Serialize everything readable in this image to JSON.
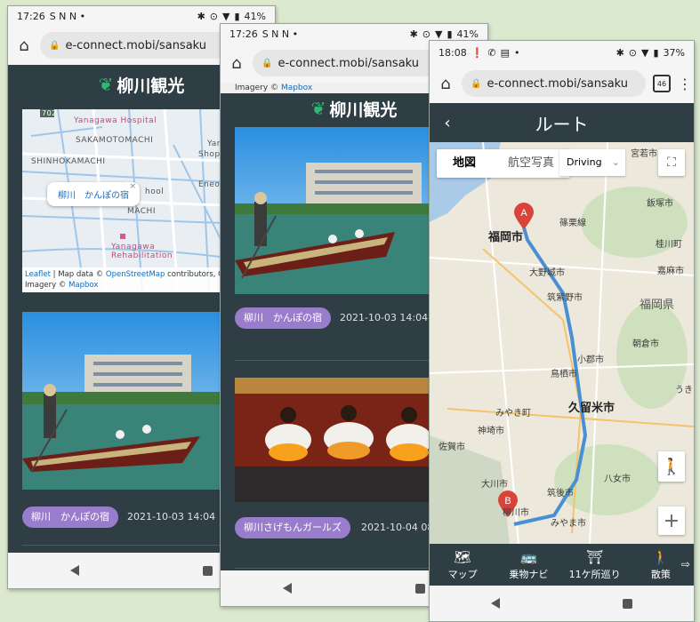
{
  "colors": {
    "app_bar": "#2f3e45",
    "chip": "#9a7ccc",
    "route_line": "#4a8fd4",
    "marker": "#d9433a",
    "brand_green": "#2eb872"
  },
  "phone1": {
    "status": {
      "time": "17:26",
      "icons_left": "S N N •",
      "battery": "41%"
    },
    "url": "e-connect.mobi/sansaku",
    "brand": "柳川観光",
    "map": {
      "labels": [
        "Yanagawa Hospital",
        "SAKAMOTOMACHI",
        "SHINHOKAMACHI",
        "MACHI",
        "Yanagawa Rehabilitation",
        "702",
        "Yan",
        "Shopp",
        "hool",
        "Eneos"
      ],
      "popup": "柳川　かんぽの宿",
      "attribution": {
        "prefix": "Leaflet",
        "middle": " | Map data © ",
        "osm": "OpenStreetMap",
        "suffix": " contributors, CC",
        "imagery": "Imagery © ",
        "mapbox": "Mapbox"
      }
    },
    "card": {
      "chip": "柳川　かんぽの宿",
      "date": "2021-10-03 14:04"
    }
  },
  "phone2": {
    "status": {
      "time": "17:26",
      "icons_left": "S N N •",
      "battery": "41%"
    },
    "url": "e-connect.mobi/sansaku",
    "brand": "柳川観光",
    "attribution": {
      "imagery": "Imagery © ",
      "mapbox": "Mapbox"
    },
    "cards": [
      {
        "chip": "柳川　かんぽの宿",
        "date": "2021-10-03 14:04"
      },
      {
        "chip": "柳川さげもんガールズ",
        "date": "2021-10-04 08:"
      }
    ]
  },
  "phone3": {
    "status": {
      "time": "18:08",
      "battery": "37%"
    },
    "url": "e-connect.mobi/sansaku",
    "tab_count": "46",
    "title": "ルート",
    "map_types": [
      "地図",
      "航空写真"
    ],
    "travel_mode": "Driving",
    "markers": [
      "A",
      "B"
    ],
    "place_labels": [
      "福岡市",
      "大野城市",
      "筑紫野市",
      "鳥栖市",
      "久留米市",
      "小郡市",
      "みやま市",
      "佐賀市",
      "神埼市",
      "大川市",
      "柳川市",
      "筑後市",
      "八女市",
      "朝倉市",
      "福岡県",
      "嘉麻市",
      "飯塚市",
      "宮若市",
      "篠栗線",
      "みやき町",
      "うき",
      "桂川町"
    ],
    "tabs": [
      {
        "icon": "map-pin-icon",
        "label": "マップ"
      },
      {
        "icon": "bus-icon",
        "label": "乗物ナビ"
      },
      {
        "icon": "temple-icon",
        "label": "11ケ所巡り"
      },
      {
        "icon": "walk-icon",
        "label": "散策"
      }
    ]
  }
}
